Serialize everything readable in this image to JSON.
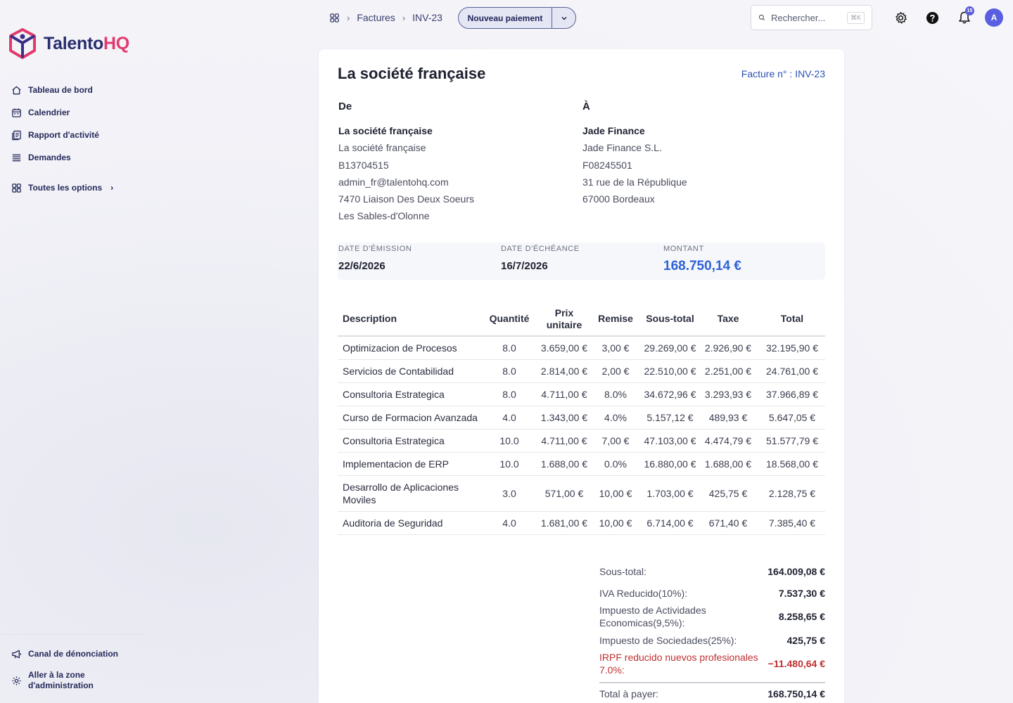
{
  "brand": {
    "name_main": "Talento",
    "name_accent": "HQ"
  },
  "sidebar": {
    "items": [
      {
        "label": "Tableau de bord",
        "icon": "home-icon"
      },
      {
        "label": "Calendrier",
        "icon": "calendar-icon"
      },
      {
        "label": "Rapport d'activité",
        "icon": "report-icon"
      },
      {
        "label": "Demandes",
        "icon": "list-icon"
      }
    ],
    "all_options": "Toutes les options",
    "bottom": {
      "whistleblow": "Canal de dénonciation",
      "admin_line1": "Aller à la zone",
      "admin_line2": "d'administration"
    }
  },
  "topbar": {
    "breadcrumb": [
      "Factures",
      "INV-23"
    ],
    "new_payment": "Nouveau paiement",
    "search_placeholder": "Rechercher...",
    "search_shortcut": "⌘K",
    "notification_count": "15",
    "avatar_initial": "A"
  },
  "invoice": {
    "title": "La société française",
    "number": "Facture n° : INV-23",
    "from": {
      "heading": "De",
      "name": "La société française",
      "lines": [
        "La société française",
        "B13704515",
        "admin_fr@talentohq.com",
        "7470 Liaison Des Deux Soeurs",
        "Les Sables-d'Olonne"
      ]
    },
    "to": {
      "heading": "À",
      "name": "Jade Finance",
      "lines": [
        "Jade Finance S.L.",
        "F08245501",
        "31 rue de la République",
        "67000 Bordeaux"
      ]
    },
    "dates": {
      "issue_label": "DATE D'ÉMISSION",
      "issue": "22/6/2026",
      "due_label": "DATE D'ÉCHÉANCE",
      "due": "16/7/2026",
      "amount_label": "MONTANT",
      "amount": "168.750,14 €"
    },
    "columns": {
      "description": "Description",
      "quantity": "Quantité",
      "unit_price_1": "Prix",
      "unit_price_2": "unitaire",
      "discount": "Remise",
      "subtotal": "Sous-total",
      "tax": "Taxe",
      "total": "Total"
    },
    "rows": [
      {
        "desc": "Optimizacion de Procesos",
        "qty": "8.0",
        "price": "3.659,00 €",
        "disc": "3,00 €",
        "sub": "29.269,00 €",
        "tax": "2.926,90 €",
        "total": "32.195,90 €"
      },
      {
        "desc": "Servicios de Contabilidad",
        "qty": "8.0",
        "price": "2.814,00 €",
        "disc": "2,00 €",
        "sub": "22.510,00 €",
        "tax": "2.251,00 €",
        "total": "24.761,00 €"
      },
      {
        "desc": "Consultoria Estrategica",
        "qty": "8.0",
        "price": "4.711,00 €",
        "disc": "8.0%",
        "sub": "34.672,96 €",
        "tax": "3.293,93 €",
        "total": "37.966,89 €"
      },
      {
        "desc": "Curso de Formacion Avanzada",
        "qty": "4.0",
        "price": "1.343,00 €",
        "disc": "4.0%",
        "sub": "5.157,12 €",
        "tax": "489,93 €",
        "total": "5.647,05 €"
      },
      {
        "desc": "Consultoria Estrategica",
        "qty": "10.0",
        "price": "4.711,00 €",
        "disc": "7,00 €",
        "sub": "47.103,00 €",
        "tax": "4.474,79 €",
        "total": "51.577,79 €"
      },
      {
        "desc": "Implementacion de ERP",
        "qty": "10.0",
        "price": "1.688,00 €",
        "disc": "0.0%",
        "sub": "16.880,00 €",
        "tax": "1.688,00 €",
        "total": "18.568,00 €"
      },
      {
        "desc": "Desarrollo de Aplicaciones Moviles",
        "qty": "3.0",
        "price": "571,00 €",
        "disc": "10,00 €",
        "sub": "1.703,00 €",
        "tax": "425,75 €",
        "total": "2.128,75 €"
      },
      {
        "desc": "Auditoria de Seguridad",
        "qty": "4.0",
        "price": "1.681,00 €",
        "disc": "10,00 €",
        "sub": "6.714,00 €",
        "tax": "671,40 €",
        "total": "7.385,40 €"
      }
    ],
    "totals": [
      {
        "label": "Sous-total:",
        "value": "164.009,08 €"
      },
      {
        "label": "IVA Reducido(10%):",
        "value": "7.537,30 €"
      },
      {
        "label": "Impuesto de Actividades Economicas(9,5%):",
        "value": "8.258,65 €"
      },
      {
        "label": "Impuesto de Sociedades(25%):",
        "value": "425,75 €"
      },
      {
        "label": "IRPF reducido nuevos profesionales 7.0%:",
        "value": "−11.480,64 €",
        "negative": true
      }
    ],
    "final_total": {
      "label": "Total à payer:",
      "value": "168.750,14 €"
    }
  },
  "colors": {
    "brand_navy": "#2a2d6e",
    "brand_pink": "#e23a6d",
    "accent_blue": "#2f62d8",
    "negative_red": "#c03030"
  }
}
